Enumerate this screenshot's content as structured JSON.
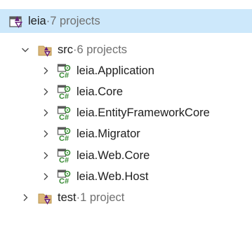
{
  "solution": {
    "name": "leia",
    "separator": " · ",
    "count": "7 projects"
  },
  "folders": [
    {
      "name": "src",
      "count": "6 projects",
      "expanded": true,
      "projects": [
        {
          "name": "leia.Application",
          "has_chevron": true
        },
        {
          "name": "leia.Core",
          "has_chevron": true
        },
        {
          "name": "leia.EntityFrameworkCore",
          "has_chevron": true
        },
        {
          "name": "leia.Migrator",
          "has_chevron": true
        },
        {
          "name": "leia.Web.Core",
          "has_chevron": true
        },
        {
          "name": "leia.Web.Host",
          "has_chevron": true
        }
      ]
    },
    {
      "name": "test",
      "count": "1 project",
      "expanded": false
    }
  ],
  "icons": {
    "solution": "solution-icon",
    "folder": "solution-folder-icon",
    "project": "csharp-project-icon",
    "expanded": "chevron-down-icon",
    "collapsed": "chevron-right-icon"
  },
  "colors": {
    "selection": "#cde8fb",
    "meta_text": "#707070",
    "csharp_green": "#388a34",
    "solution_purple": "#68217a",
    "folder_yellow": "#dcb67a"
  }
}
